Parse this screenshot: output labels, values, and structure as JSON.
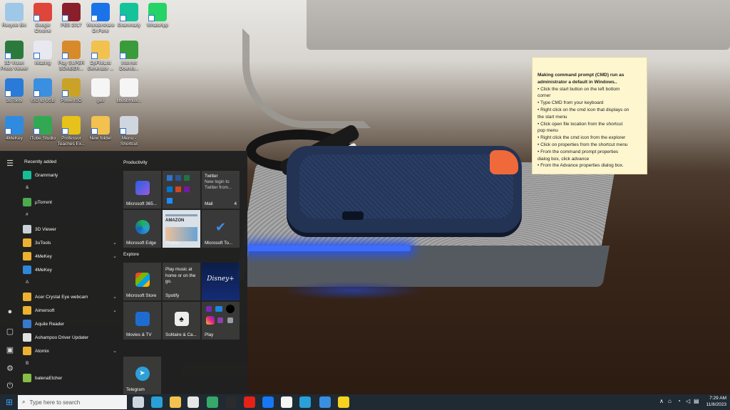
{
  "desktop_icons": [
    {
      "label": "Recycle Bin",
      "icon": "recycle-bin-icon",
      "color": "#9fc7e8"
    },
    {
      "label": "Google Chrome",
      "icon": "chrome-icon",
      "color": "#e0453a"
    },
    {
      "label": "PES 2017",
      "icon": "pes-icon",
      "color": "#8a1f2b"
    },
    {
      "label": "Wondershare Dr.Fone",
      "icon": "drfone-icon",
      "color": "#1a73e8"
    },
    {
      "label": "Grammarly",
      "icon": "grammarly-icon",
      "color": "#15c39a"
    },
    {
      "label": "WhatsApp",
      "icon": "whatsapp-icon",
      "color": "#25d366"
    },
    {
      "label": "3D Vision Photo Viewer",
      "icon": "3d-vision-icon",
      "color": "#2b7a3b"
    },
    {
      "label": "iMazing",
      "icon": "imazing-icon",
      "color": "#e8e8f0"
    },
    {
      "label": "Play SUPER BOMBER...",
      "icon": "super-bomber-icon",
      "color": "#d88a2a"
    },
    {
      "label": "DpFileList Generator ...",
      "icon": "folder-icon",
      "color": "#f2c14e"
    },
    {
      "label": "Internet Downlo...",
      "icon": "idm-icon",
      "color": "#3a9b3a"
    },
    {
      "label": "3uTools",
      "icon": "3utools-icon",
      "color": "#2a7bd8"
    },
    {
      "label": "ISO to USB",
      "icon": "iso-usb-icon",
      "color": "#3a8fe0"
    },
    {
      "label": "PowerISO",
      "icon": "poweriso-icon",
      "color": "#c9a227"
    },
    {
      "label": "geli",
      "icon": "file-icon",
      "color": "#f5f5f5"
    },
    {
      "label": "libusbmux...",
      "icon": "file-icon",
      "color": "#f5f5f5"
    },
    {
      "label": "4MeKey",
      "icon": "4mekey-icon",
      "color": "#2f8be0"
    },
    {
      "label": "iTube Studio",
      "icon": "itube-icon",
      "color": "#33a852"
    },
    {
      "label": "Professor Teaches Ex...",
      "icon": "professor-icon",
      "color": "#e6c21a"
    },
    {
      "label": "New folder",
      "icon": "folder-icon",
      "color": "#f2c14e"
    },
    {
      "label": "Menu - Shortcut",
      "icon": "menu-shortcut-icon",
      "color": "#d0d6e0"
    }
  ],
  "sticky": {
    "title": "Making command prompt (CMD) run as administrator a default in Windows..",
    "lines": [
      "• Click the start button on the left bottom",
      "corner",
      "• Type CMD from your keyboard",
      "• Right click on the cmd icon that displays on",
      "the start menu",
      "• Click open file location from the shortcut",
      "pop menu",
      "• Right click the cmd icon from the explorer",
      "• Click on properties from the shortcut menu",
      "• From the command prompt properties",
      "dialog box, click advance",
      "• From the Advance properties dialog box."
    ]
  },
  "start_menu": {
    "recently_added": "Recently added",
    "apps": [
      {
        "kind": "app",
        "label": "Grammarly",
        "color": "#15c39a"
      },
      {
        "kind": "letter",
        "label": "&"
      },
      {
        "kind": "app",
        "label": "µTorrent",
        "color": "#4caf50"
      },
      {
        "kind": "letter",
        "label": "#"
      },
      {
        "kind": "app",
        "label": "3D Viewer",
        "color": "#cfd8dc"
      },
      {
        "kind": "folder",
        "label": "3uTools",
        "color": "#f2b632",
        "chev": "⌄"
      },
      {
        "kind": "folder",
        "label": "4MeKey",
        "color": "#f2b632",
        "chev": "⌄"
      },
      {
        "kind": "app",
        "label": "4MeKey",
        "color": "#2f8be0"
      },
      {
        "kind": "letter",
        "label": "A"
      },
      {
        "kind": "folder",
        "label": "Acer Crystal Eye webcam",
        "color": "#f2b632",
        "chev": "⌄"
      },
      {
        "kind": "folder",
        "label": "Aimersoft",
        "color": "#f2b632",
        "chev": "⌄"
      },
      {
        "kind": "app",
        "label": "Aquile Reader",
        "color": "#3a7bd5"
      },
      {
        "kind": "app",
        "label": "Ashampoo Driver Updater",
        "color": "#e8e8e8"
      },
      {
        "kind": "folder",
        "label": "Atomix",
        "color": "#f2b632",
        "chev": "⌄"
      },
      {
        "kind": "letter",
        "label": "B"
      },
      {
        "kind": "app",
        "label": "balenaEtcher",
        "color": "#8bc34a"
      }
    ],
    "productivity": "Productivity",
    "explore": "Explore",
    "tiles": {
      "m365": "Microsoft 365...",
      "twitter_title": "Twitter",
      "twitter_text": "New login to Twitter from...",
      "mail": "Mail",
      "mail_count": "4",
      "edge": "Microsoft Edge",
      "photos": "Photos",
      "photos_banner": "AMAZON",
      "todo": "Microsoft To...",
      "store": "Microsoft Store",
      "spotify_text": "Play music at home or on the go.",
      "spotify": "Spotify",
      "disney": "Disney+",
      "movies": "Movies & TV",
      "solitaire": "Solitaire & Ca...",
      "play": "Play",
      "telegram": "Telegram"
    }
  },
  "taskbar": {
    "search_placeholder": "Type here to search",
    "time": "7:29 AM",
    "date": "11/8/2023",
    "apps": [
      {
        "name": "task-view-icon",
        "color": "#cfd6dd"
      },
      {
        "name": "edge-icon",
        "color": "#2aa0d8"
      },
      {
        "name": "file-explorer-icon",
        "color": "#f2c14e"
      },
      {
        "name": "store-icon",
        "color": "#e6e6e6"
      },
      {
        "name": "edge-dev-icon",
        "color": "#35a86a"
      },
      {
        "name": "hat-icon",
        "color": "#2b2b2b"
      },
      {
        "name": "youtube-icon",
        "color": "#e62117"
      },
      {
        "name": "facebook-icon",
        "color": "#1877f2"
      },
      {
        "name": "word-icon",
        "color": "#f5f5f5"
      },
      {
        "name": "edge-beta-icon",
        "color": "#2aa0d8"
      },
      {
        "name": "mail-icon",
        "color": "#3a8fe0"
      },
      {
        "name": "sticky-notes-icon",
        "color": "#f7d21e"
      }
    ]
  }
}
